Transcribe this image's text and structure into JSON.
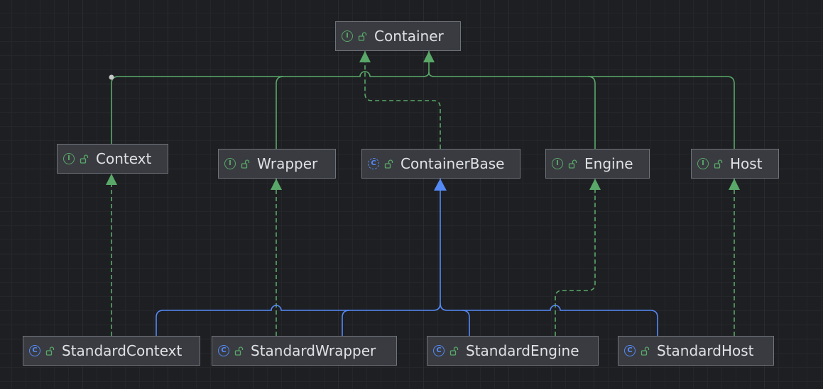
{
  "diagram": {
    "nodes": [
      {
        "id": "container",
        "label": "Container",
        "kind": "interface",
        "kind_glyph": "I"
      },
      {
        "id": "context",
        "label": "Context",
        "kind": "interface",
        "kind_glyph": "I"
      },
      {
        "id": "wrapper",
        "label": "Wrapper",
        "kind": "interface",
        "kind_glyph": "I"
      },
      {
        "id": "containerbase",
        "label": "ContainerBase",
        "kind": "abstract",
        "kind_glyph": "C"
      },
      {
        "id": "engine",
        "label": "Engine",
        "kind": "interface",
        "kind_glyph": "I"
      },
      {
        "id": "host",
        "label": "Host",
        "kind": "interface",
        "kind_glyph": "I"
      },
      {
        "id": "standardcontext",
        "label": "StandardContext",
        "kind": "class",
        "kind_glyph": "C"
      },
      {
        "id": "standardwrapper",
        "label": "StandardWrapper",
        "kind": "class",
        "kind_glyph": "C"
      },
      {
        "id": "standardengine",
        "label": "StandardEngine",
        "kind": "class",
        "kind_glyph": "C"
      },
      {
        "id": "standardhost",
        "label": "StandardHost",
        "kind": "class",
        "kind_glyph": "C"
      }
    ],
    "edges": [
      {
        "from": "context",
        "to": "container",
        "type": "extends",
        "style": "solid",
        "color": "#59a869"
      },
      {
        "from": "wrapper",
        "to": "container",
        "type": "extends",
        "style": "solid",
        "color": "#59a869"
      },
      {
        "from": "engine",
        "to": "container",
        "type": "extends",
        "style": "solid",
        "color": "#59a869"
      },
      {
        "from": "host",
        "to": "container",
        "type": "extends",
        "style": "solid",
        "color": "#59a869"
      },
      {
        "from": "containerbase",
        "to": "container",
        "type": "implements",
        "style": "dashed",
        "color": "#59a869"
      },
      {
        "from": "standardcontext",
        "to": "context",
        "type": "implements",
        "style": "dashed",
        "color": "#59a869"
      },
      {
        "from": "standardwrapper",
        "to": "wrapper",
        "type": "implements",
        "style": "dashed",
        "color": "#59a869"
      },
      {
        "from": "standardengine",
        "to": "engine",
        "type": "implements",
        "style": "dashed",
        "color": "#59a869"
      },
      {
        "from": "standardhost",
        "to": "host",
        "type": "implements",
        "style": "dashed",
        "color": "#59a869"
      },
      {
        "from": "standardcontext",
        "to": "containerbase",
        "type": "extends",
        "style": "solid",
        "color": "#548af7"
      },
      {
        "from": "standardwrapper",
        "to": "containerbase",
        "type": "extends",
        "style": "solid",
        "color": "#548af7"
      },
      {
        "from": "standardengine",
        "to": "containerbase",
        "type": "extends",
        "style": "solid",
        "color": "#548af7"
      },
      {
        "from": "standardhost",
        "to": "containerbase",
        "type": "extends",
        "style": "solid",
        "color": "#548af7"
      }
    ]
  },
  "colors": {
    "background": "#1e1f22",
    "node_fill": "#393b40",
    "node_border": "#6f737a",
    "text": "#dfe1e5",
    "interface_accent": "#59a869",
    "class_accent": "#548af7"
  },
  "icons": {
    "interface": "interface-icon",
    "class": "class-icon",
    "abstract": "abstract-class-icon",
    "visibility": "public-unlock-icon"
  }
}
